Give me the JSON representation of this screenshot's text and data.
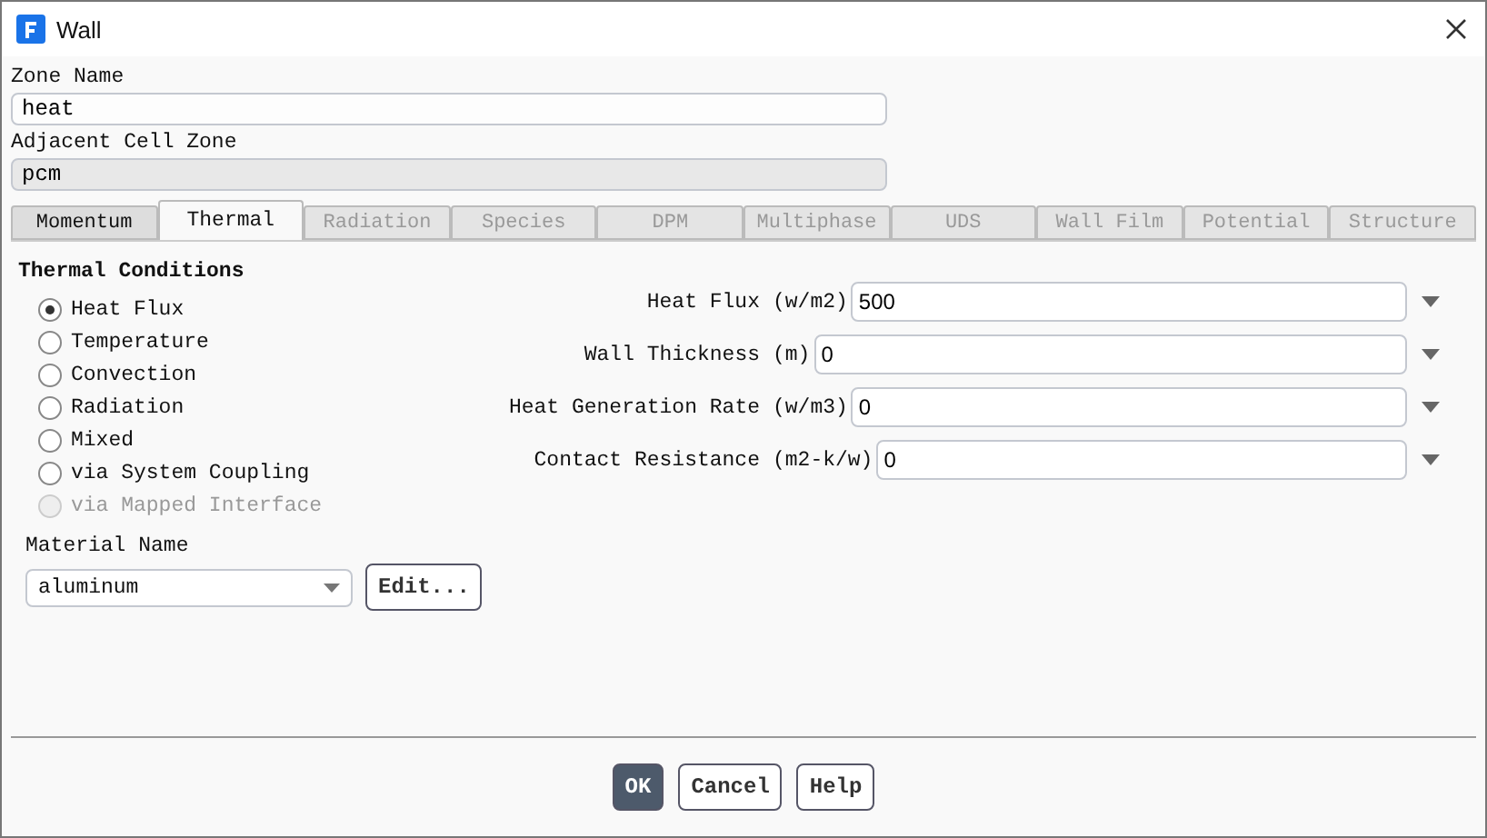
{
  "window": {
    "title": "Wall"
  },
  "zone_name": {
    "label": "Zone Name",
    "value": "heat"
  },
  "adjacent_cell_zone": {
    "label": "Adjacent Cell Zone",
    "value": "pcm"
  },
  "tabs": [
    {
      "label": "Momentum",
      "selected": false,
      "disabled": false
    },
    {
      "label": "Thermal",
      "selected": true,
      "disabled": false
    },
    {
      "label": "Radiation",
      "selected": false,
      "disabled": true
    },
    {
      "label": "Species",
      "selected": false,
      "disabled": true
    },
    {
      "label": "DPM",
      "selected": false,
      "disabled": true
    },
    {
      "label": "Multiphase",
      "selected": false,
      "disabled": true
    },
    {
      "label": "UDS",
      "selected": false,
      "disabled": true
    },
    {
      "label": "Wall Film",
      "selected": false,
      "disabled": true
    },
    {
      "label": "Potential",
      "selected": false,
      "disabled": true
    },
    {
      "label": "Structure",
      "selected": false,
      "disabled": true
    }
  ],
  "thermal_conditions": {
    "title": "Thermal Conditions",
    "options": [
      {
        "label": "Heat Flux",
        "selected": true,
        "disabled": false
      },
      {
        "label": "Temperature",
        "selected": false,
        "disabled": false
      },
      {
        "label": "Convection",
        "selected": false,
        "disabled": false
      },
      {
        "label": "Radiation",
        "selected": false,
        "disabled": false
      },
      {
        "label": "Mixed",
        "selected": false,
        "disabled": false
      },
      {
        "label": "via System Coupling",
        "selected": false,
        "disabled": false
      },
      {
        "label": "via Mapped Interface",
        "selected": false,
        "disabled": true
      }
    ]
  },
  "material": {
    "label": "Material Name",
    "value": "aluminum",
    "edit_button": "Edit..."
  },
  "parameters": [
    {
      "label": "Heat Flux",
      "unit": "(w/m2)",
      "value": "500"
    },
    {
      "label": "Wall Thickness",
      "unit": "(m)",
      "value": "0"
    },
    {
      "label": "Heat Generation Rate",
      "unit": "(w/m3)",
      "value": "0"
    },
    {
      "label": "Contact Resistance",
      "unit": "(m2-k/w)",
      "value": "0"
    }
  ],
  "buttons": [
    {
      "label": "OK",
      "kind": "primary"
    },
    {
      "label": "Cancel",
      "kind": "normal"
    },
    {
      "label": "Help",
      "kind": "normal"
    }
  ]
}
